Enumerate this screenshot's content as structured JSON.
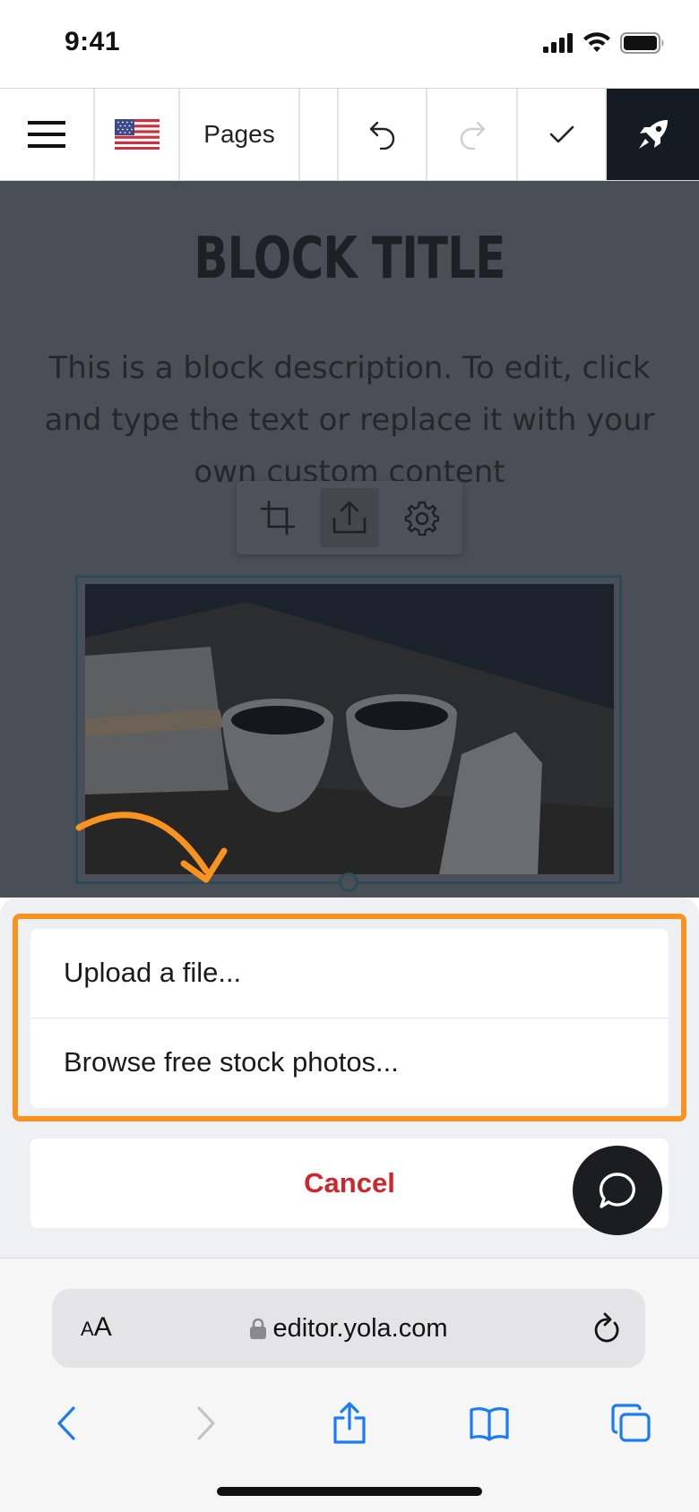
{
  "status_bar": {
    "time": "9:41"
  },
  "toolbar": {
    "pages_label": "Pages",
    "items": [
      "menu-icon",
      "us-flag-icon",
      "pages",
      "undo-icon",
      "redo-icon",
      "check-icon",
      "rocket-icon"
    ]
  },
  "canvas": {
    "title": "BLOCK TITLE",
    "description": "This is a block description. To edit, click and type the text or replace it with your own custom content",
    "image_tools": [
      "crop-icon",
      "upload-icon",
      "gear-icon"
    ]
  },
  "action_sheet": {
    "upload_label": "Upload a file...",
    "browse_label": "Browse free stock photos...",
    "cancel_label": "Cancel",
    "highlight_color": "#f7931e",
    "cancel_color": "#d0252b"
  },
  "browser": {
    "text_size_label_small": "A",
    "text_size_label_large": "A",
    "url": "editor.yola.com"
  },
  "colors": {
    "publish_bg": "#151b23",
    "overlay": "#4a4f57",
    "link_blue": "#1a7cf2"
  }
}
